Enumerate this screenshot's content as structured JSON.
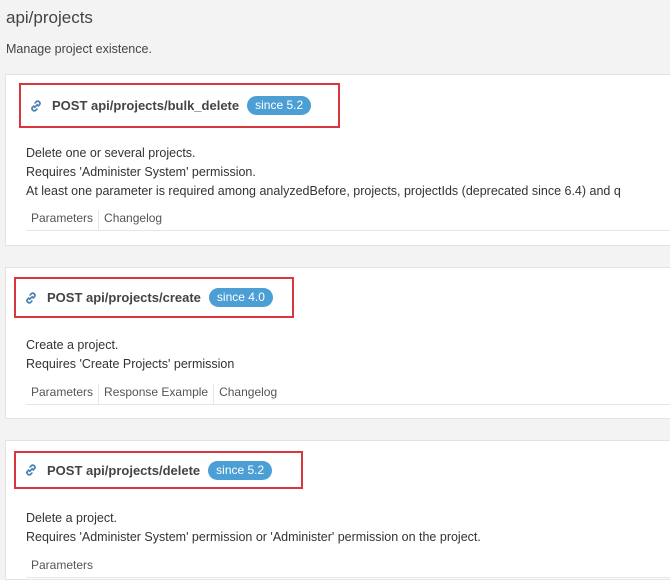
{
  "page": {
    "title": "api/projects",
    "description": "Manage project existence."
  },
  "endpoints": [
    {
      "title": "POST api/projects/bulk_delete",
      "since": "since 5.2",
      "description": [
        "Delete one or several projects.",
        "Requires 'Administer System' permission.",
        "At least one parameter is required among analyzedBefore, projects, projectIds (deprecated since 6.4) and q"
      ],
      "tabs": [
        "Parameters",
        "Changelog"
      ]
    },
    {
      "title": "POST api/projects/create",
      "since": "since 4.0",
      "description": [
        "Create a project.",
        "Requires 'Create Projects' permission"
      ],
      "tabs": [
        "Parameters",
        "Response Example",
        "Changelog"
      ]
    },
    {
      "title": "POST api/projects/delete",
      "since": "since 5.2",
      "description": [
        "Delete a project.",
        "Requires 'Administer System' permission or 'Administer' permission on the project."
      ],
      "tabs": [
        "Parameters"
      ]
    }
  ],
  "colors": {
    "badge": "#4b9fd5",
    "highlight_border": "#d9363e"
  },
  "icons": {
    "endpoint": "link-icon"
  }
}
